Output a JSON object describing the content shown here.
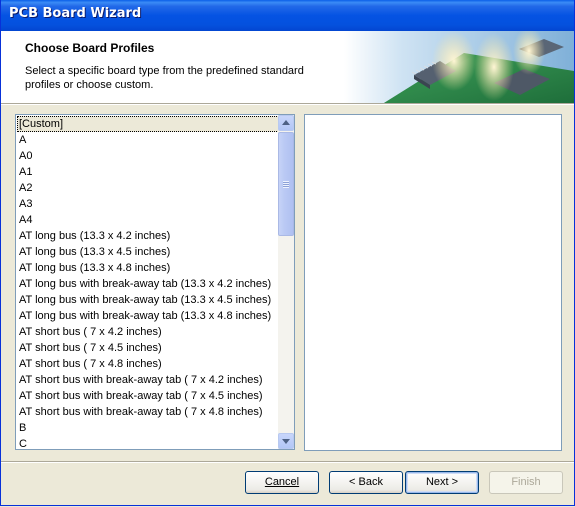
{
  "window": {
    "title": "PCB Board Wizard"
  },
  "header": {
    "title": "Choose Board Profiles",
    "description": "Select a specific board type from the predefined standard profiles or choose custom."
  },
  "profiles": {
    "selected_index": 0,
    "items": [
      "[Custom]",
      "A",
      "A0",
      "A1",
      "A2",
      "A3",
      "A4",
      "AT long bus (13.3 x 4.2 inches)",
      "AT long bus (13.3 x 4.5 inches)",
      "AT long bus (13.3 x 4.8 inches)",
      "AT long bus with break-away tab (13.3 x 4.2 inches)",
      "AT long bus with break-away tab (13.3 x 4.5 inches)",
      "AT long bus with break-away tab (13.3 x 4.8 inches)",
      "AT short bus ( 7 x 4.2 inches)",
      "AT short bus ( 7 x 4.5 inches)",
      "AT short bus ( 7 x 4.8 inches)",
      "AT short bus with break-away tab ( 7 x 4.2 inches)",
      "AT short bus with break-away tab ( 7 x 4.5 inches)",
      "AT short bus with break-away tab ( 7 x 4.8 inches)",
      "B",
      "C"
    ]
  },
  "buttons": {
    "cancel": "Cancel",
    "back": "< Back",
    "next": "Next >",
    "finish": "Finish"
  },
  "colors": {
    "titlebar": "#0553E3",
    "face": "#ECE9D8",
    "border": "#7F9DB9"
  }
}
